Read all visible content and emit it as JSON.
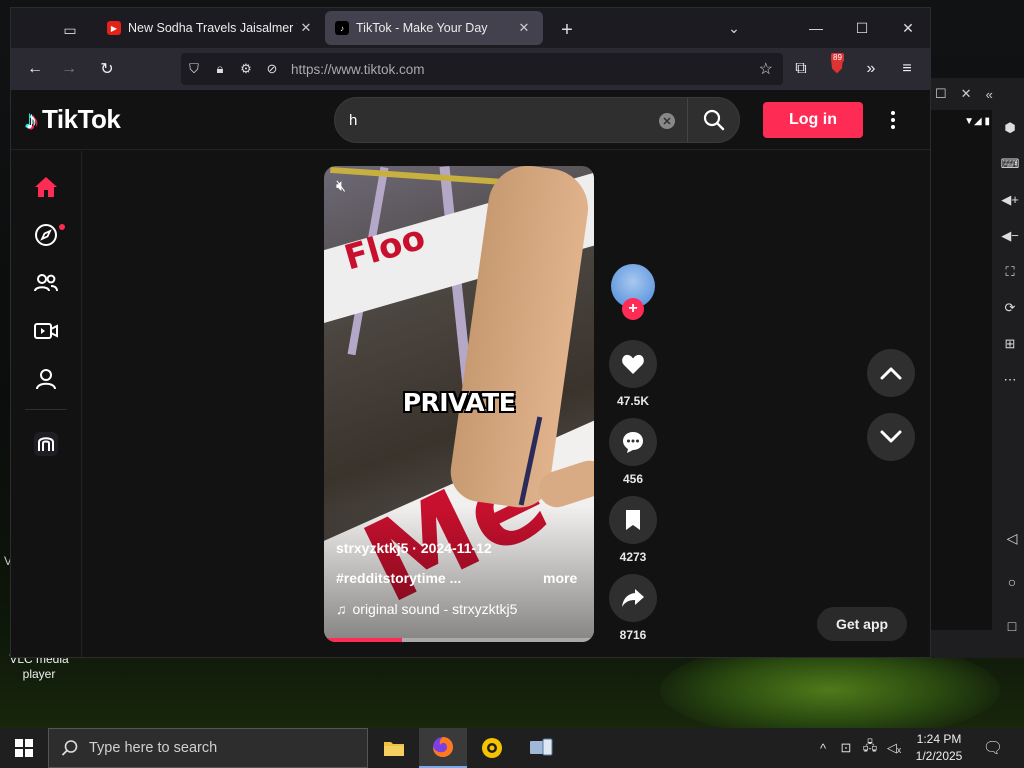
{
  "browser": {
    "tabs": [
      {
        "title": "New Sodha Travels Jaisalmer To",
        "favicon": "youtube-icon",
        "active": false
      },
      {
        "title": "TikTok - Make Your Day",
        "favicon": "tiktok-icon",
        "active": true
      }
    ],
    "url": "https://www.tiktok.com",
    "extension_badge": "89"
  },
  "tiktok": {
    "logo_text": "TikTok",
    "search": {
      "value": "h"
    },
    "login_label": "Log in",
    "sidebar": [
      "home-icon",
      "explore-icon",
      "following-icon",
      "live-icon",
      "profile-icon",
      "creator-icon"
    ],
    "video": {
      "overlay_text": "PRIVATE",
      "author_line": "strxyzktkj5 · 2024-11-12",
      "caption": "#redditstorytime ...",
      "more_label": "more",
      "sound": "original sound - strxyzktkj5",
      "progress": 0.29
    },
    "actions": {
      "likes": "47.5K",
      "comments": "456",
      "saves": "4273",
      "shares": "8716"
    },
    "get_app_label": "Get app"
  },
  "desktop": {
    "icon_label": "VLC media player",
    "edge_text": "V"
  },
  "taskbar": {
    "search_placeholder": "Type here to search",
    "time": "1:24 PM",
    "date": "1/2/2025"
  },
  "colors": {
    "tiktok_red": "#fe2c55",
    "tiktok_cyan": "#25f4ee",
    "browser_tab_active": "#42414d"
  }
}
